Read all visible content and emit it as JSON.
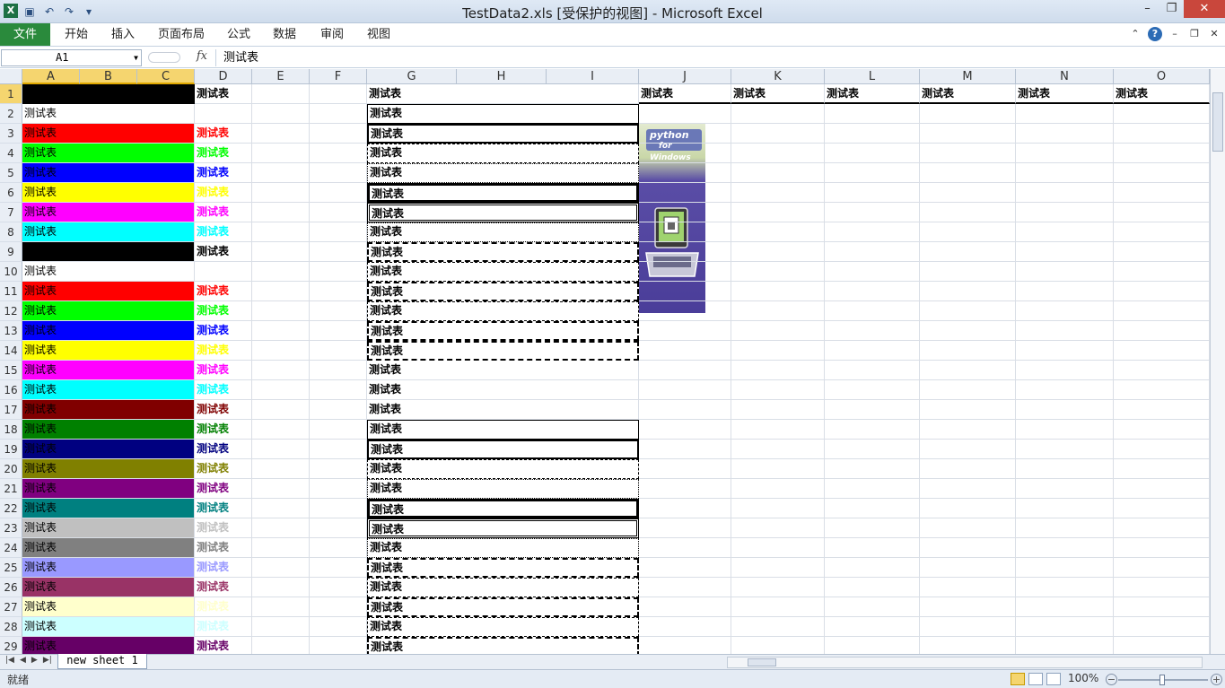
{
  "window": {
    "title": "TestData2.xls  [受保护的视图] - Microsoft Excel"
  },
  "ribbon": {
    "file": "文件",
    "tabs": [
      "开始",
      "插入",
      "页面布局",
      "公式",
      "数据",
      "审阅",
      "视图"
    ]
  },
  "formula_bar": {
    "name_box": "A1",
    "fx": "fx",
    "content": "测试表"
  },
  "columns": [
    "A",
    "B",
    "C",
    "D",
    "E",
    "F",
    "G",
    "H",
    "I",
    "J",
    "K",
    "L",
    "M",
    "N",
    "O"
  ],
  "rows": [
    "1",
    "2",
    "3",
    "4",
    "5",
    "6",
    "7",
    "8",
    "9",
    "10",
    "11",
    "12",
    "13",
    "14",
    "15",
    "16",
    "17",
    "18",
    "19",
    "20",
    "21",
    "22",
    "23",
    "24",
    "25",
    "26",
    "27",
    "28",
    "29"
  ],
  "cell_text": "测试表",
  "a_fill_colors": [
    "#000000",
    "#ffffff",
    "#ff0000",
    "#00ff00",
    "#0000ff",
    "#ffff00",
    "#ff00ff",
    "#00ffff",
    "#000000",
    "#ffffff",
    "#ff0000",
    "#00ff00",
    "#0000ff",
    "#ffff00",
    "#ff00ff",
    "#00ffff",
    "#800000",
    "#008000",
    "#000080",
    "#808000",
    "#800080",
    "#008080",
    "#c0c0c0",
    "#808080",
    "#9999ff",
    "#993366",
    "#ffffcc",
    "#ccffff",
    "#660066"
  ],
  "a_text_visible": [
    false,
    true,
    true,
    true,
    true,
    true,
    true,
    true,
    false,
    true,
    true,
    true,
    true,
    true,
    true,
    true,
    true,
    true,
    true,
    true,
    true,
    true,
    true,
    true,
    true,
    true,
    true,
    true,
    true
  ],
  "d_font_colors": [
    "#000000",
    "",
    "#ff0000",
    "#00ff00",
    "#0000ff",
    "#ffff00",
    "#ff00ff",
    "#00ffff",
    "#000000",
    "",
    "#ff0000",
    "#00ff00",
    "#0000ff",
    "#ffff00",
    "#ff00ff",
    "#00ffff",
    "#800000",
    "#008000",
    "#000080",
    "#808000",
    "#800080",
    "#008080",
    "#c0c0c0",
    "#808080",
    "#9999ff",
    "#993366",
    "#ffffcc",
    "#ccffff",
    "#660066"
  ],
  "g_border_styles": [
    "none",
    "1px solid #000",
    "2px solid #000",
    "1px dashed #000",
    "1px dotted #000",
    "3px solid #000",
    "3px double #000",
    "1px dotted #000",
    "2px dashed #000",
    "1px dashed #000",
    "2px dashed #000",
    "1px dashed #000",
    "2px dashed #000",
    "2px dashed #000",
    "none",
    "none",
    "none",
    "1px solid #000",
    "2px solid #000",
    "1px dashed #000",
    "1px dotted #000",
    "3px solid #000",
    "3px double #000",
    "1px dotted #000",
    "2px dashed #000",
    "1px dashed #000",
    "2px dashed #000",
    "1px dashed #000",
    "2px dashed #000"
  ],
  "row1_labels": [
    "测试表",
    "测试表",
    "测试表",
    "测试表",
    "测试表",
    "测试表",
    "测试表",
    "测试表",
    "测试表"
  ],
  "image": {
    "brand": "python",
    "subtitle": "for Windows"
  },
  "sheet_tabs": [
    "new sheet 1"
  ],
  "status": {
    "text": "就绪",
    "zoom": "100%"
  }
}
